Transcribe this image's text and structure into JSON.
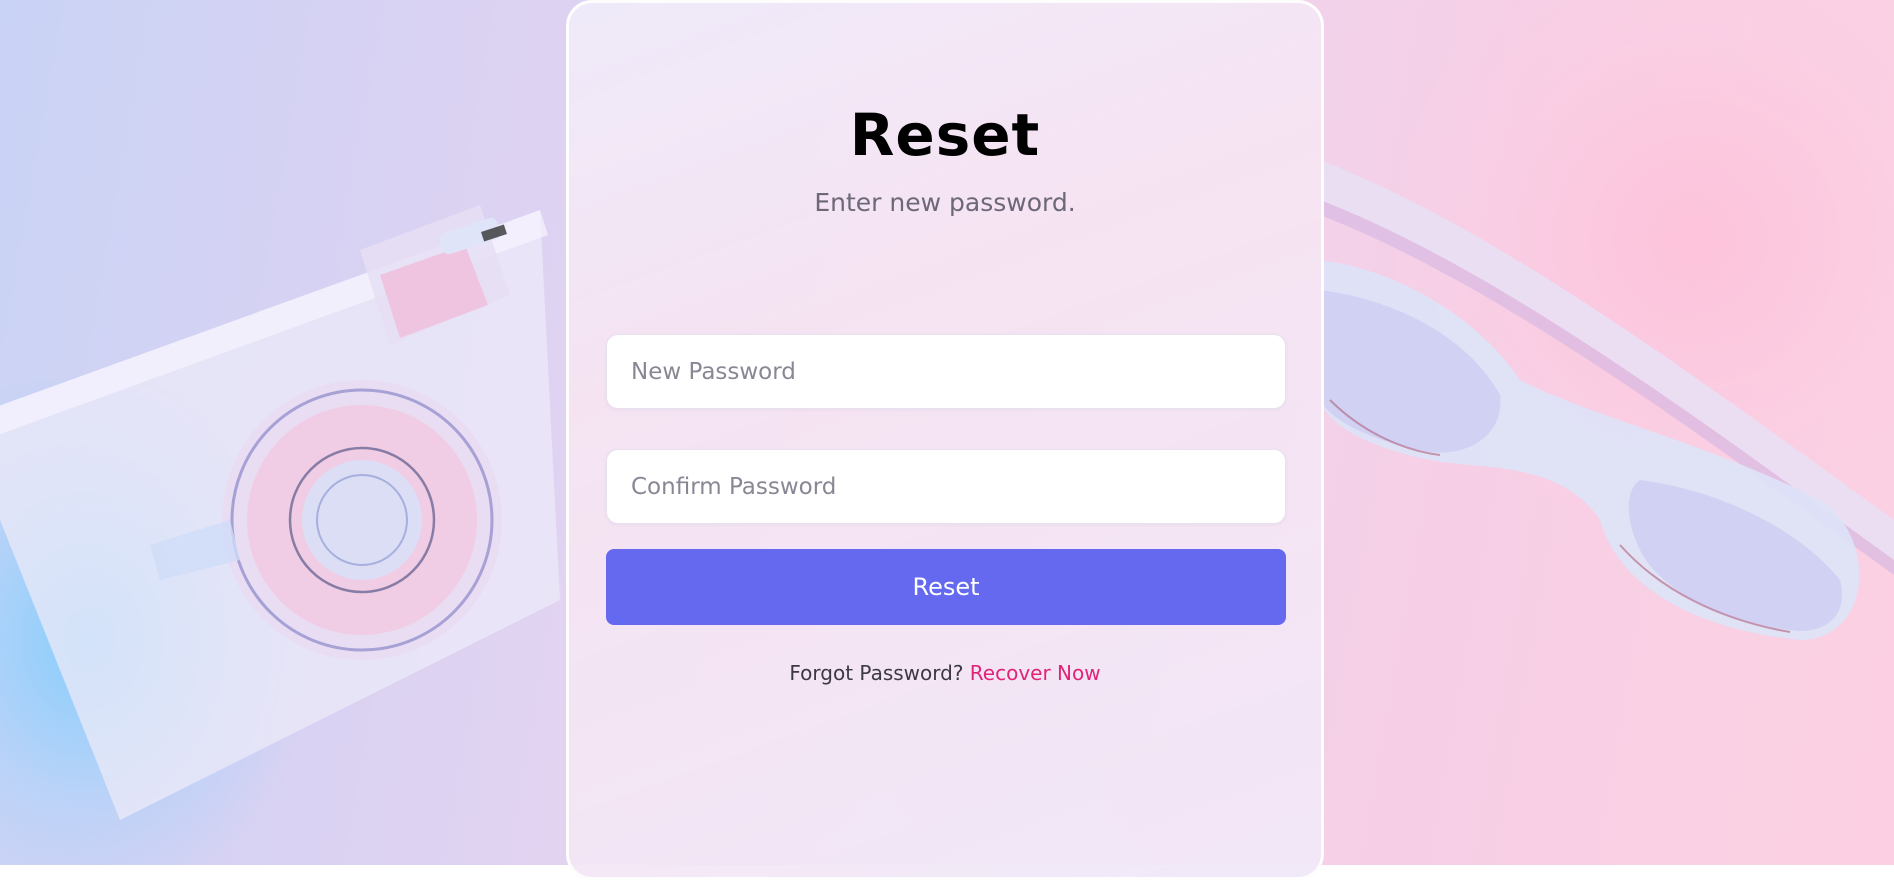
{
  "form": {
    "title": "Reset",
    "subtitle": "Enter new password.",
    "new_password_placeholder": "New Password",
    "confirm_password_placeholder": "Confirm Password",
    "submit_label": "Reset",
    "footer_text": "Forgot Password?",
    "footer_link": "Recover Now"
  },
  "colors": {
    "button": "#6469f0",
    "link": "#e0247a",
    "background_left": "#c9d3f5",
    "background_right": "#fcd0e2"
  },
  "background": {
    "left_object_icon": "camera-icon",
    "right_object_icon": "sunglasses-icon"
  }
}
